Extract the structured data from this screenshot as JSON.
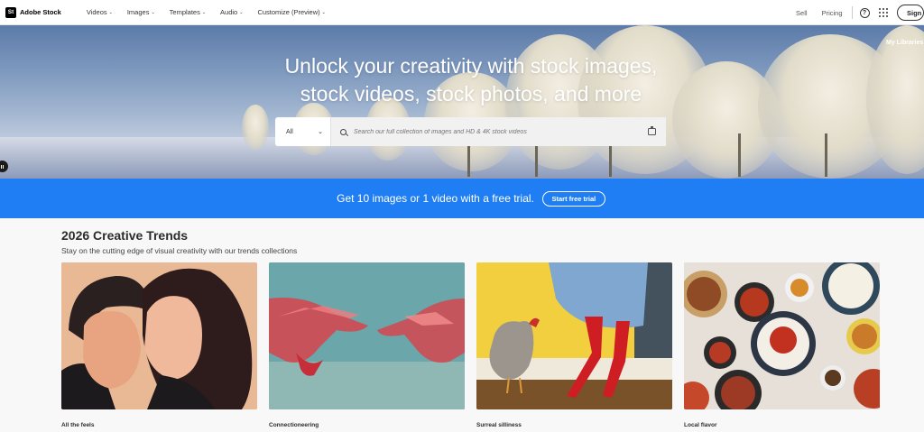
{
  "nav": {
    "logo_mark": "St",
    "logo_text": "Adobe Stock",
    "menu": [
      {
        "label": "Videos",
        "chevron": "⌄"
      },
      {
        "label": "Images",
        "chevron": "⌄"
      },
      {
        "label": "Templates",
        "chevron": "⌄"
      },
      {
        "label": "Audio",
        "chevron": "⌄"
      },
      {
        "label": "Customize (Preview)",
        "chevron": "⌄"
      }
    ],
    "sell": "Sell",
    "pricing": "Pricing",
    "help_glyph": "?",
    "signin": "Sign"
  },
  "hero": {
    "title_line1": "Unlock your creativity with stock images,",
    "title_line2": "stock videos, stock photos, and more",
    "my_libraries": "My Libraries",
    "search": {
      "category": "All",
      "placeholder": "Search our full collection of images and HD & 4K stock videos"
    }
  },
  "trial": {
    "text": "Get 10 images or 1 video with a free trial.",
    "button": "Start free trial"
  },
  "trends": {
    "title": "2026 Creative Trends",
    "subtitle": "Stay on the cutting edge of visual creativity with our trends collections",
    "cards": [
      {
        "label": "All the feels"
      },
      {
        "label": "Connectioneering"
      },
      {
        "label": "Surreal silliness"
      },
      {
        "label": "Local flavor"
      }
    ]
  },
  "colors": {
    "trial_bar": "#1f7ef3",
    "nav_bg": "#ffffff"
  }
}
